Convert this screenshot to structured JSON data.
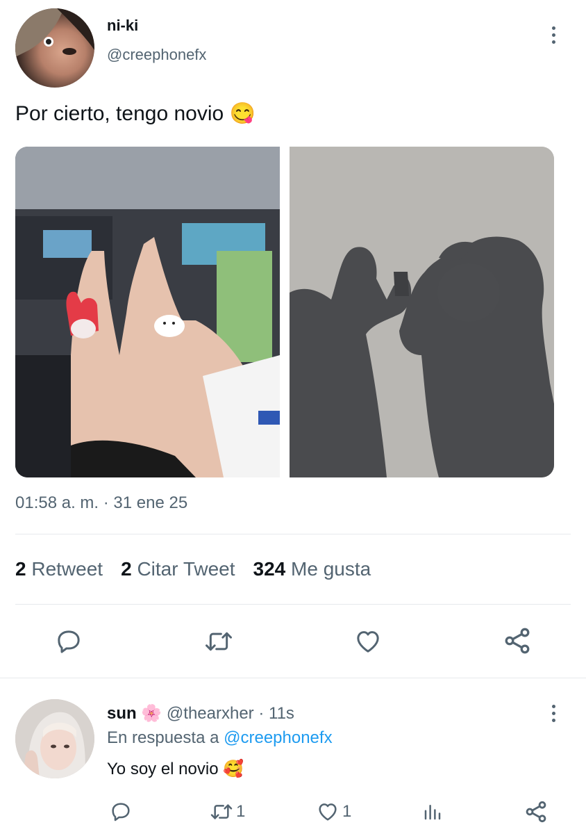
{
  "tweet": {
    "display_name": "ni-ki",
    "handle": "@creephonefx",
    "text": "Por cierto, tengo novio",
    "emoji": "😋",
    "timestamp": "01:58 a. m. · 31 ene 25",
    "stats": {
      "retweet_count": "2",
      "retweet_label": "Retweet",
      "quote_count": "2",
      "quote_label": "Citar Tweet",
      "like_count": "324",
      "like_label": "Me gusta"
    },
    "actions": [
      "reply-icon",
      "retweet-icon",
      "like-icon",
      "share-icon"
    ]
  },
  "reply": {
    "display_name": "sun",
    "name_emoji": "🌸",
    "handle": "@thearxher",
    "time": "· 11s",
    "in_reply_prefix": "En respuesta a",
    "in_reply_handle": "@creephonefx",
    "text": "Yo soy el novio",
    "text_emoji": "🥰",
    "retweet_count": "1",
    "like_count": "1",
    "actions": [
      "reply-icon",
      "retweet-icon",
      "like-icon",
      "analytics-icon",
      "share-icon"
    ]
  },
  "colors": {
    "text": "#0f1419",
    "muted": "#536471",
    "link": "#1d9bf0",
    "divider": "#e6e9ec"
  }
}
